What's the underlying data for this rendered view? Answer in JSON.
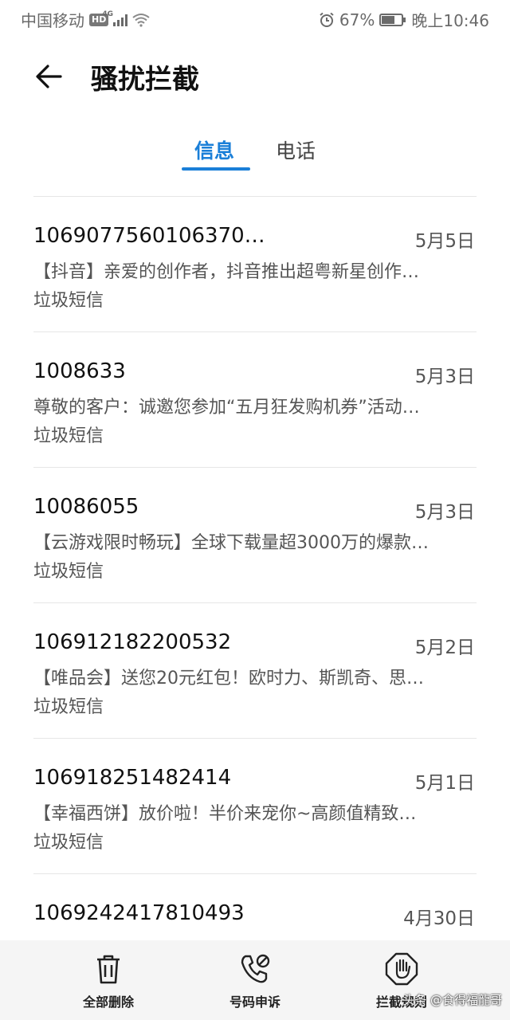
{
  "status_bar": {
    "carrier": "中国移动",
    "hd": "HD",
    "network": "4G",
    "battery_percent": "67%",
    "time": "晚上10:46"
  },
  "header": {
    "back_icon": "arrow-left-icon",
    "title": "骚扰拦截"
  },
  "tabs": [
    {
      "label": "信息",
      "active": true
    },
    {
      "label": "电话",
      "active": false
    }
  ],
  "messages": [
    {
      "sender": "1069077560106370…",
      "date": "5月5日",
      "preview": "【抖音】亲爱的创作者，抖音推出超粤新星创作…",
      "tag": "垃圾短信"
    },
    {
      "sender": "1008633",
      "date": "5月3日",
      "preview": "尊敬的客户：诚邀您参加“五月狂发购机券”活动…",
      "tag": "垃圾短信"
    },
    {
      "sender": "10086055",
      "date": "5月3日",
      "preview": "【云游戏限时畅玩】全球下载量超3000万的爆款…",
      "tag": "垃圾短信"
    },
    {
      "sender": "106912182200532",
      "date": "5月2日",
      "preview": "【唯品会】送您20元红包！欧时力、斯凯奇、思…",
      "tag": "垃圾短信"
    },
    {
      "sender": "106918251482414",
      "date": "5月1日",
      "preview": "【幸福西饼】放价啦！半价来宠你~高颜值精致…",
      "tag": "垃圾短信"
    },
    {
      "sender": "1069242417810493",
      "date": "4月30日",
      "preview": "",
      "tag": ""
    }
  ],
  "bottom_bar": {
    "delete_all": {
      "label": "全部删除",
      "icon": "trash-icon"
    },
    "appeal": {
      "label": "号码申诉",
      "icon": "phone-appeal-icon"
    },
    "rules": {
      "label": "拦截规则",
      "icon": "hand-stop-icon"
    }
  },
  "watermark": "头条 @食得福龍哥",
  "colors": {
    "accent": "#1a7fd8"
  }
}
